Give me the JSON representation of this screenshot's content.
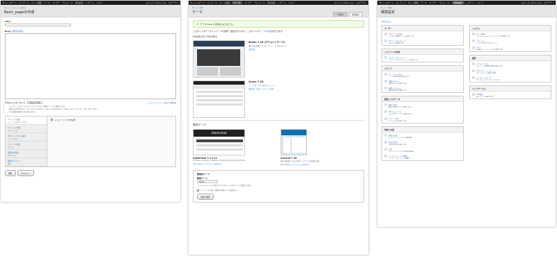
{
  "toolbar": {
    "items": [
      "ダッシュボード",
      "コンテンツ",
      "サイト構築",
      "テーマ",
      "ユーザー",
      "モジュール",
      "環境設定",
      "レポート",
      "ヘルプ"
    ],
    "greeting": "ようこそ admin さん",
    "logout": "ログアウト"
  },
  "panel1": {
    "breadcrumb": "ホーム » コンテンツの追加",
    "title": "Basic_pageの作成",
    "title_label": "Title",
    "body_label": "Body",
    "body_link": "(要約を編集)",
    "format_label": "テキストフォーマット",
    "format_value": "Filtered HTML",
    "format_help_link": "テキストフォーマットに関する詳細情報",
    "tips": [
      "ウェブページのアドレスとメールアドレスは、自動的にリンクへ変換されます。",
      "使用できるHTMLタグ：<a> <em> <strong> <cite> <blockquote> <code> <ul> <ol> <li> <dl> <dt> <dd>",
      "行と段落は自動的に折り返されます。"
    ],
    "vtabs": [
      {
        "title": "メニューの設定",
        "summary": "メニューに含まれていません"
      },
      {
        "title": "リビジョン情報",
        "summary": "リビジョンなし"
      },
      {
        "title": "URLエイリアスの設定",
        "summary": "エイリアスなし"
      },
      {
        "title": "コメントの設定",
        "summary": "クローズ"
      },
      {
        "title": "投稿者の情報",
        "summary": "admin さん"
      },
      {
        "title": "掲載オプション",
        "summary": "掲載"
      }
    ],
    "menu_checkbox": "メニューリンクを生成",
    "save": "保存",
    "preview": "プレビュー"
  },
  "panel2": {
    "breadcrumb": "ホーム » 管理",
    "title": "テーマ",
    "tabs": [
      "一覧表示",
      "環境設定"
    ],
    "message": "テーマ Seven が有効になりました。",
    "intro": "このサイトのデフォルトテーマの選択・設定を行います。このサイトの",
    "intro_link": "テーマの追加",
    "intro_end": "が行えます。",
    "enabled_heading": "ENABLED THEMES",
    "enabled": [
      {
        "name": "Bartik 7.38 (デフォルトテーマ)",
        "desc": "柔軟で色を変更でき、多くのリージョンがあるテーマ。",
        "actions": [
          "環境設定"
        ]
      },
      {
        "name": "Seven 7.38",
        "desc": "シンプルな「すぐに使える」テーマ。",
        "actions": [
          "環境設定",
          "無効",
          "デフォルトに設定"
        ]
      }
    ],
    "disabled_heading": "無効テーマ",
    "disabled": [
      {
        "name": "Adminimal 7.x-1.21",
        "desc": "A simple one-column, tableless, minimalist administration theme",
        "actions": [
          "有効",
          "有効にしてデフォルトに設定する"
        ],
        "logo": "Adminimal"
      },
      {
        "name": "Garland 7.38",
        "desc": "流れる固定幅、または可変レイアウトで色が変更可能。",
        "actions": [
          "有効",
          "有効にしてデフォルトに設定する"
        ]
      }
    ],
    "admin_heading": "管理用テーマ",
    "admin_label": "管理テーマ",
    "admin_value": "Seven",
    "admin_help": "「デフォルトテーマ」を選ぶとすべてのページに同じテーマが使用されます。",
    "admin_checkbox": "コンテンツの作成・編集時に管理テーマを使用する",
    "admin_save": "設定を保存"
  },
  "panel3": {
    "breadcrumb": "ホーム » 管理",
    "title": "環境設定",
    "toggle": "説明を非表示",
    "left": [
      {
        "heading": "ユーザー",
        "items": [
          {
            "t": "アカウントの設定",
            "d": "デフォルトの動作とメールを設定します。"
          },
          {
            "t": "IPアドレスのブロック",
            "d": "IPアドレスを管理します。"
          }
        ]
      },
      {
        "heading": "コンテンツの作成",
        "items": [
          {
            "t": "テキストフォーマット",
            "d": "コンテンツへの入力フォーマットを設定します。"
          }
        ]
      },
      {
        "heading": "メディア",
        "items": [
          {
            "t": "ファイルシステム",
            "d": "ファイルの保存場所を設定します。"
          },
          {
            "t": "画像スタイル",
            "d": "画像のスタイルを設定します。"
          },
          {
            "t": "画像ツールキット",
            "d": "画像の処理方法を選択します。"
          }
        ]
      },
      {
        "heading": "検索とメタデータ",
        "items": [
          {
            "t": "検索の設定",
            "d": "関連する検索エンジンを設定します。"
          },
          {
            "t": "URL エイリアス",
            "d": "URL パスのエイリアスを変更します。"
          },
          {
            "t": "クリーンURL",
            "d": "クリーンURLを有効にします。"
          }
        ]
      },
      {
        "heading": "地域と言語",
        "items": [
          {
            "t": "地域の設定",
            "d": "タイムゾーンとデフォルトの国を設定。"
          },
          {
            "t": "日付と時刻",
            "d": "日付の表示形式を設定します。"
          },
          {
            "t": "言語",
            "d": "コンテンツとユーザーのための言語設定。"
          },
          {
            "t": "インターフェースの翻訳",
            "d": "ユーザーインターフェースの翻訳。"
          }
        ]
      }
    ],
    "right": [
      {
        "heading": "システム",
        "items": [
          {
            "t": "サイト情報",
            "d": "サイト名、e-mailアドレス、スローガンを変更します。"
          },
          {
            "t": "アクション",
            "d": "トリガーで実行できるアクション。"
          },
          {
            "t": "cron",
            "d": "定期的なメンテナンスタスクを管理します。"
          }
        ]
      },
      {
        "heading": "開発",
        "items": [
          {
            "t": "パフォーマンス",
            "d": "キャッシュと帯域幅の最適化を設定します。"
          },
          {
            "t": "ログとエラーメッセージ",
            "d": "エラーメッセージの表示と記録。"
          },
          {
            "t": "メンテナンスモード",
            "d": "サイトをメンテナンスモードにします。"
          }
        ]
      },
      {
        "heading": "ウェブサービス",
        "items": [
          {
            "t": "RSS配信",
            "d": "RSS フィードを設定します。"
          }
        ]
      }
    ]
  }
}
